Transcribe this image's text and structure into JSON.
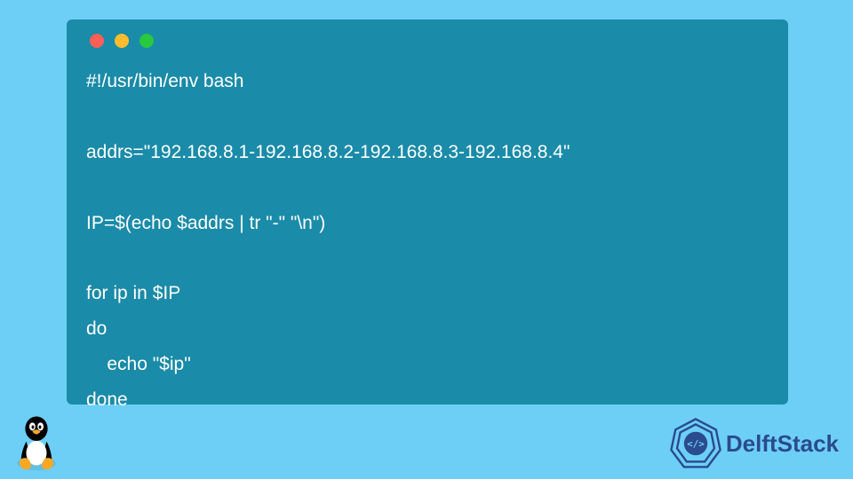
{
  "code": {
    "line1": "#!/usr/bin/env bash",
    "line2": "",
    "line3": "addrs=\"192.168.8.1-192.168.8.2-192.168.8.3-192.168.8.4\"",
    "line4": "",
    "line5": "IP=$(echo $addrs | tr \"-\" \"\\n\")",
    "line6": "",
    "line7": "for ip in $IP",
    "line8": "do",
    "line9": "    echo \"$ip\"",
    "line10": "done"
  },
  "brand": {
    "name": "DelftStack"
  },
  "colors": {
    "background": "#6dcff6",
    "window": "#1a8ba8",
    "text": "#ffffff",
    "brand": "#2a4b8d"
  }
}
